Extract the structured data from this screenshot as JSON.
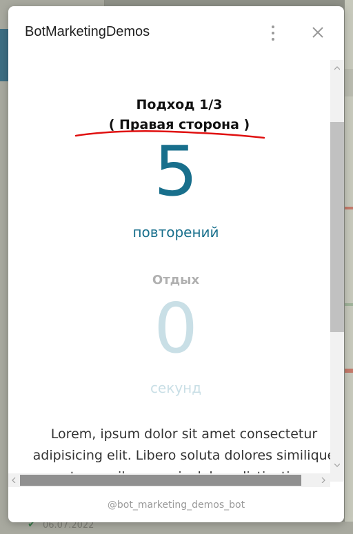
{
  "modal": {
    "title": "BotMarketingDemos",
    "footer": "@bot_marketing_demos_bot"
  },
  "workout": {
    "set_label": "Подход 1/3",
    "side_label": "( Правая сторона )",
    "reps_value": "5",
    "reps_unit": "повторений",
    "rest_label": "Отдых",
    "rest_value": "0",
    "rest_unit": "секунд",
    "description_line1": "Lorem, ipsum dolor sit amet consectetur",
    "description_line2": "adipisicing elit. Libero soluta dolores similique",
    "description_line3": "temporibus omnis dolore distinctio"
  },
  "background": {
    "date": "06.07.2022"
  },
  "icons": {
    "menu": "kebab-menu-icon",
    "close": "close-icon"
  },
  "colors": {
    "accent": "#186f8c",
    "rest_faded": "#c9dfe6",
    "underline": "#e01010"
  }
}
